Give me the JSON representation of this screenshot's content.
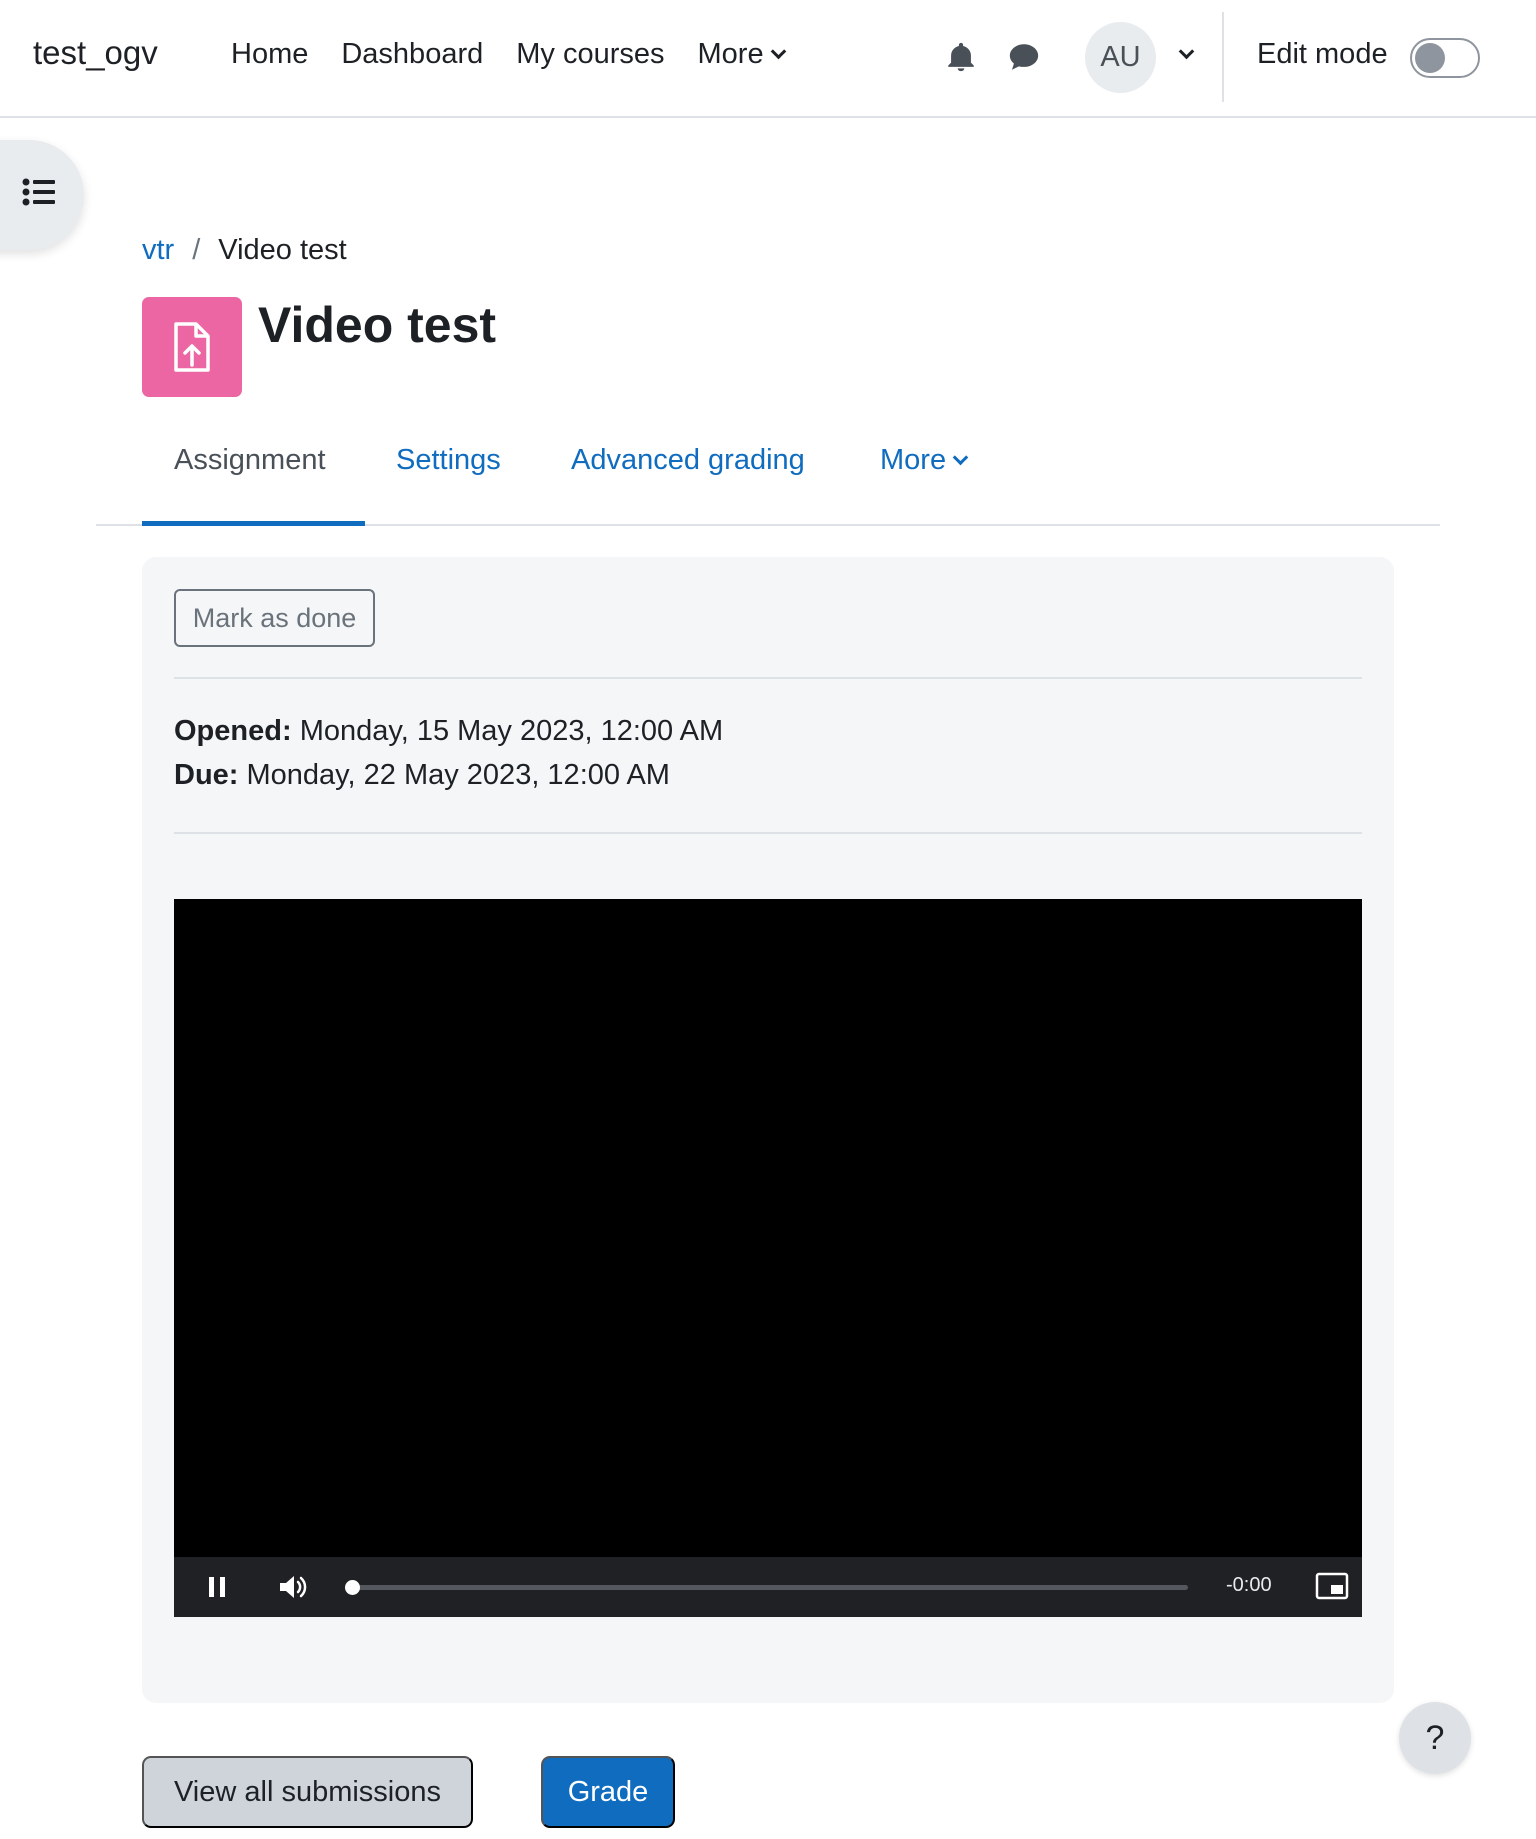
{
  "navbar": {
    "brand": "test_ogv",
    "items": [
      "Home",
      "Dashboard",
      "My courses",
      "More"
    ],
    "avatar_initials": "AU",
    "edit_mode_label": "Edit mode",
    "edit_mode_on": false
  },
  "breadcrumb": {
    "parent": "vtr",
    "separator": "/",
    "current": "Video test"
  },
  "page": {
    "title": "Video test",
    "icon_color": "#eb66a2"
  },
  "secondary_nav": {
    "tabs": [
      "Assignment",
      "Settings",
      "Advanced grading",
      "More"
    ],
    "active": "Assignment"
  },
  "activity": {
    "mark_done_label": "Mark as done",
    "opened_label": "Opened:",
    "opened_value": "Monday, 15 May 2023, 12:00 AM",
    "due_label": "Due:",
    "due_value": "Monday, 22 May 2023, 12:00 AM"
  },
  "video": {
    "time_display": "-0:00",
    "progress": 0,
    "state": "playing"
  },
  "footer": {
    "view_submissions_label": "View all submissions",
    "grade_label": "Grade"
  },
  "help_label": "?",
  "colors": {
    "accent": "#0f6cbf",
    "panel_bg": "#f5f6f8"
  }
}
